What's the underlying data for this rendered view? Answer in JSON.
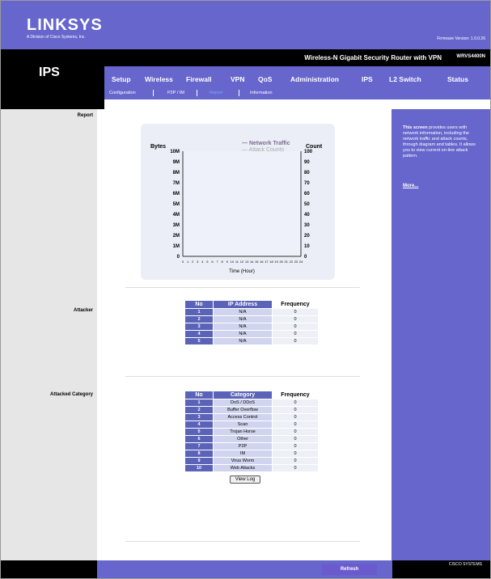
{
  "brand": {
    "logo": "LINKSYS",
    "sub": "A Division of Cisco Systems, Inc.",
    "firmware": "Firmware Version: 1.0.0.26"
  },
  "product": {
    "name": "Wireless-N Gigabit Security Router with VPN",
    "model": "WRVS4400N"
  },
  "section_title": "IPS",
  "tabs": [
    "Setup",
    "Wireless",
    "Firewall",
    "VPN",
    "QoS",
    "Administration",
    "IPS",
    "L2 Switch",
    "Status"
  ],
  "subnav": [
    "Configuration",
    "P2P / IM",
    "Report",
    "Information"
  ],
  "left_labels": {
    "report": "Report",
    "attacker": "Attacker",
    "attacked_category": "Attacked Category"
  },
  "help": {
    "bold": "This screen",
    "text": " provides users with network information, including the network traffic and attack counts, through diagram and tables. It allows you to view current on-line attack pattern.",
    "more": "More..."
  },
  "chart_data": {
    "type": "line",
    "ylabel_left": "Bytes",
    "ylabel_right": "Count",
    "xlabel": "Time (Hour)",
    "legend": [
      "Network Traffic",
      "Attack Counts"
    ],
    "y_ticks_left": [
      "0",
      "1M",
      "2M",
      "3M",
      "4M",
      "5M",
      "6M",
      "7M",
      "8M",
      "9M",
      "10M"
    ],
    "y_ticks_right": [
      "0",
      "10",
      "20",
      "30",
      "40",
      "50",
      "60",
      "70",
      "80",
      "90",
      "100"
    ],
    "x_ticks": [
      "0",
      "1",
      "2",
      "3",
      "4",
      "5",
      "6",
      "7",
      "8",
      "9",
      "10",
      "11",
      "12",
      "13",
      "14",
      "15",
      "16",
      "17",
      "18",
      "19",
      "20",
      "21",
      "22",
      "23",
      "24"
    ],
    "series": [
      {
        "name": "Network Traffic",
        "values": []
      },
      {
        "name": "Attack Counts",
        "values": []
      }
    ]
  },
  "attacker": {
    "headers": [
      "No",
      "IP Address",
      "Frequency"
    ],
    "rows": [
      [
        "1",
        "N/A",
        "0"
      ],
      [
        "2",
        "N/A",
        "0"
      ],
      [
        "3",
        "N/A",
        "0"
      ],
      [
        "4",
        "N/A",
        "0"
      ],
      [
        "5",
        "N/A",
        "0"
      ]
    ]
  },
  "category": {
    "headers": [
      "No",
      "Category",
      "Frequency"
    ],
    "rows": [
      [
        "1",
        "DoS / DDoS",
        "0"
      ],
      [
        "2",
        "Buffer Overflow",
        "0"
      ],
      [
        "3",
        "Access Control",
        "0"
      ],
      [
        "4",
        "Scan",
        "0"
      ],
      [
        "5",
        "Trojan Horse",
        "0"
      ],
      [
        "6",
        "Other",
        "0"
      ],
      [
        "7",
        "P2P",
        "0"
      ],
      [
        "8",
        "IM",
        "0"
      ],
      [
        "9",
        "Virus Worm",
        "0"
      ],
      [
        "10",
        "Web Attacks",
        "0"
      ]
    ],
    "view_log": "View Log"
  },
  "footer": {
    "refresh": "Refresh",
    "cisco": "CISCO SYSTEMS"
  }
}
